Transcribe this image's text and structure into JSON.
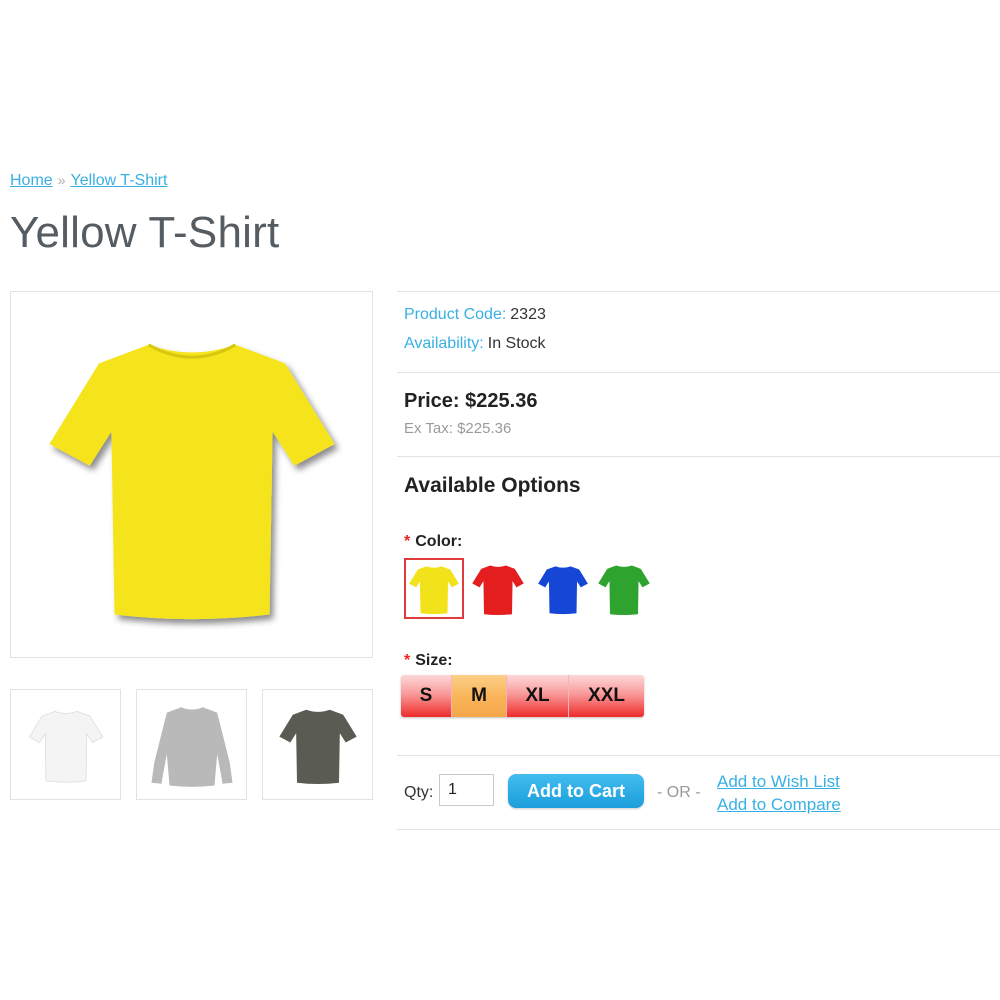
{
  "breadcrumb": {
    "home": "Home",
    "separator": "»",
    "current": "Yellow T-Shirt"
  },
  "product": {
    "title": "Yellow T-Shirt",
    "code_label": "Product Code:",
    "code_value": "2323",
    "availability_label": "Availability:",
    "availability_value": "In Stock",
    "price_text": "Price: $225.36",
    "ex_tax_text": "Ex Tax: $225.36",
    "main_image_color": "#f5e41c",
    "thumbnails": [
      {
        "color": "#f4f4f4",
        "style": "short-sleeve"
      },
      {
        "color": "#b9b9b9",
        "style": "long-sleeve"
      },
      {
        "color": "#5a5c54",
        "style": "short-sleeve"
      }
    ]
  },
  "options": {
    "heading": "Available Options",
    "required_marker": "*",
    "color_label": "Color:",
    "colors": [
      {
        "name": "yellow",
        "hex": "#f2e21a",
        "selected": true
      },
      {
        "name": "red",
        "hex": "#e41e1e",
        "selected": false
      },
      {
        "name": "blue",
        "hex": "#1546d6",
        "selected": false
      },
      {
        "name": "green",
        "hex": "#2ea32e",
        "selected": false
      }
    ],
    "size_label": "Size:",
    "sizes": [
      {
        "label": "S",
        "active": false
      },
      {
        "label": "M",
        "active": true
      },
      {
        "label": "XL",
        "active": false
      },
      {
        "label": "XXL",
        "active": false
      }
    ]
  },
  "cart": {
    "qty_label": "Qty:",
    "qty_value": "1",
    "add_to_cart": "Add to Cart",
    "or_text": "- OR -",
    "wish_list": "Add to Wish List",
    "compare": "Add to Compare"
  },
  "colors": {
    "accent": "#38b0e3",
    "button": "#1a9edb",
    "size_active": "#f5a64a",
    "size_default": "#ef2b2b"
  }
}
